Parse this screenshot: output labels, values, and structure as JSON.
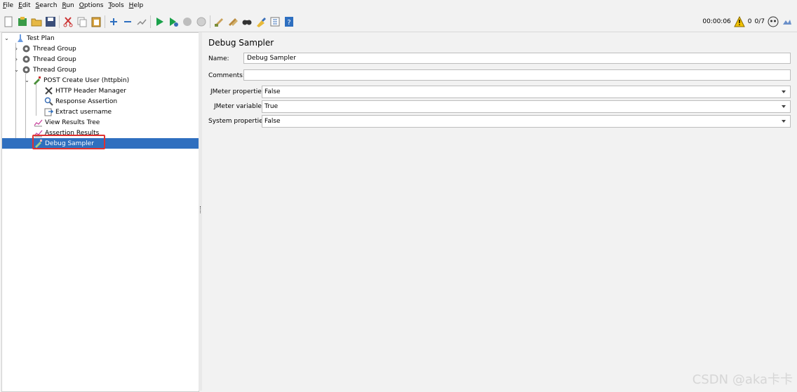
{
  "menu": [
    {
      "mn": "F",
      "rest": "ile"
    },
    {
      "mn": "E",
      "rest": "dit"
    },
    {
      "mn": "S",
      "rest": "earch"
    },
    {
      "mn": "R",
      "rest": "un"
    },
    {
      "mn": "O",
      "rest": "ptions"
    },
    {
      "mn": "T",
      "rest": "ools"
    },
    {
      "mn": "H",
      "rest": "elp"
    }
  ],
  "toolbar": {
    "timer": "00:00:06",
    "warning_count": "0",
    "threads": "0/7"
  },
  "tree": {
    "items": [
      {
        "label": "Test Plan"
      },
      {
        "label": "Thread Group"
      },
      {
        "label": "Thread Group"
      },
      {
        "label": "Thread Group"
      },
      {
        "label": "POST Create User (httpbin)"
      },
      {
        "label": "HTTP Header Manager"
      },
      {
        "label": "Response Assertion"
      },
      {
        "label": "Extract username"
      },
      {
        "label": "View Results Tree"
      },
      {
        "label": "Assertion Results"
      },
      {
        "label": "Debug Sampler"
      }
    ]
  },
  "panel": {
    "title": "Debug Sampler",
    "name_label": "Name:",
    "name_value": "Debug Sampler",
    "comments_label": "Comments:",
    "comments_value": "",
    "jmeter_props_label": "JMeter properties:",
    "jmeter_props_value": "False",
    "jmeter_vars_label": "JMeter variables:",
    "jmeter_vars_value": "True",
    "system_props_label": "System properties:",
    "system_props_value": "False"
  },
  "watermark": "CSDN @aka卡卡",
  "colors": {
    "selection": "#2f6fbf",
    "highlight_box": "#e0302f",
    "run_green": "#1aa14a",
    "warning_yellow": "#f2c200"
  }
}
